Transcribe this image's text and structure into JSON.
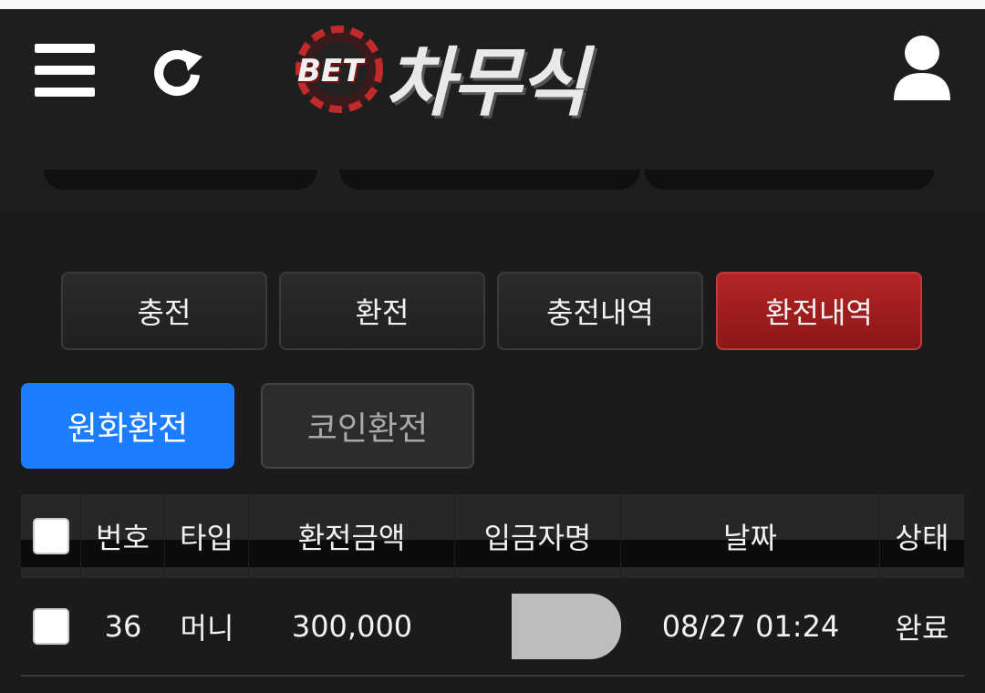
{
  "header": {
    "logo_prefix": "BET",
    "logo_word": "차무식",
    "icons": [
      "menu-icon",
      "refresh-icon",
      "user-icon"
    ]
  },
  "tabs": [
    {
      "label": "충전",
      "active": false
    },
    {
      "label": "환전",
      "active": false
    },
    {
      "label": "충전내역",
      "active": false
    },
    {
      "label": "환전내역",
      "active": true
    }
  ],
  "subtabs": [
    {
      "label": "원화환전",
      "active": true
    },
    {
      "label": "코인환전",
      "active": false
    }
  ],
  "table": {
    "columns": [
      "번호",
      "타입",
      "환전금액",
      "입금자명",
      "날짜",
      "상태"
    ],
    "rows": [
      {
        "no": "36",
        "type": "머니",
        "amount": "300,000",
        "depositor": "",
        "date": "08/27 01:24",
        "status": "완료"
      }
    ]
  },
  "colors": {
    "active_tab": "#a31e1e",
    "active_subtab": "#1c7dff",
    "background": "#1b1b1b"
  }
}
